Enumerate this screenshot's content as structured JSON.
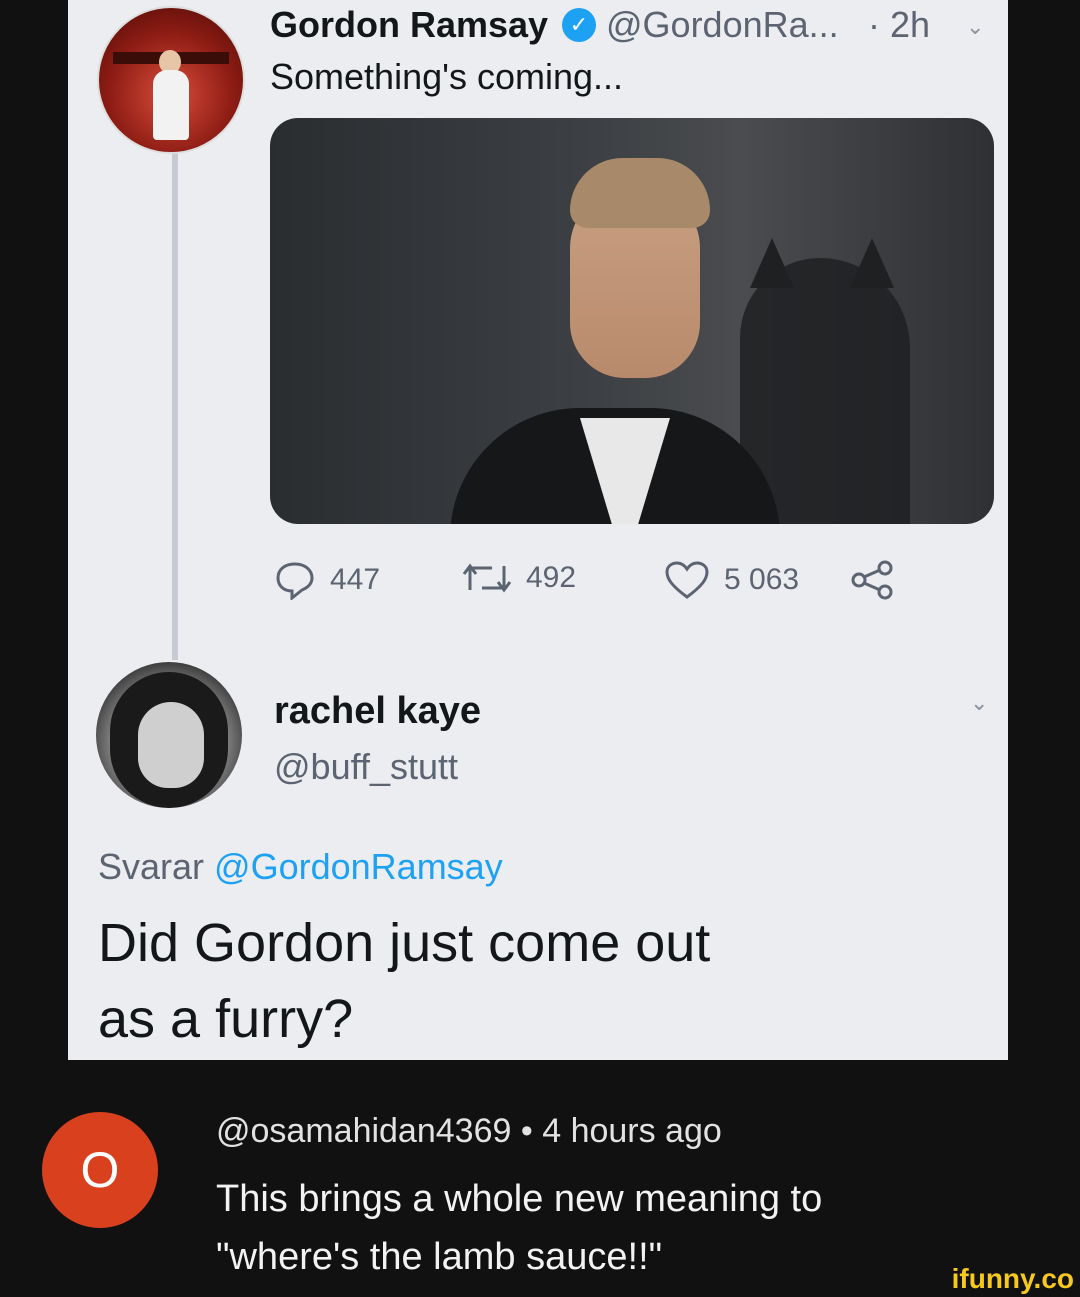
{
  "tweet": {
    "author_name": "Gordon Ramsay",
    "author_handle": "@GordonRa...",
    "time": "· 2h",
    "text": "Something's coming...",
    "stats": {
      "replies": "447",
      "retweets": "492",
      "likes": "5 063"
    }
  },
  "reply": {
    "author_name": "rachel kaye",
    "author_handle": "@buff_stutt",
    "replying_prefix": "Svarar",
    "replying_to": "@GordonRamsay",
    "text_line1": "Did Gordon just come out",
    "text_line2": "as a furry?"
  },
  "comment": {
    "avatar_letter": "O",
    "handle": "@osamahidan4369",
    "time": "• 4 hours ago",
    "line1": "This brings a whole new meaning to",
    "line2": "\"where's the lamb sauce!!\""
  },
  "watermark": "ifunny.co",
  "colors": {
    "verified": "#1da1f2",
    "comment_avatar": "#d9401e",
    "watermark": "#f7c81e"
  }
}
